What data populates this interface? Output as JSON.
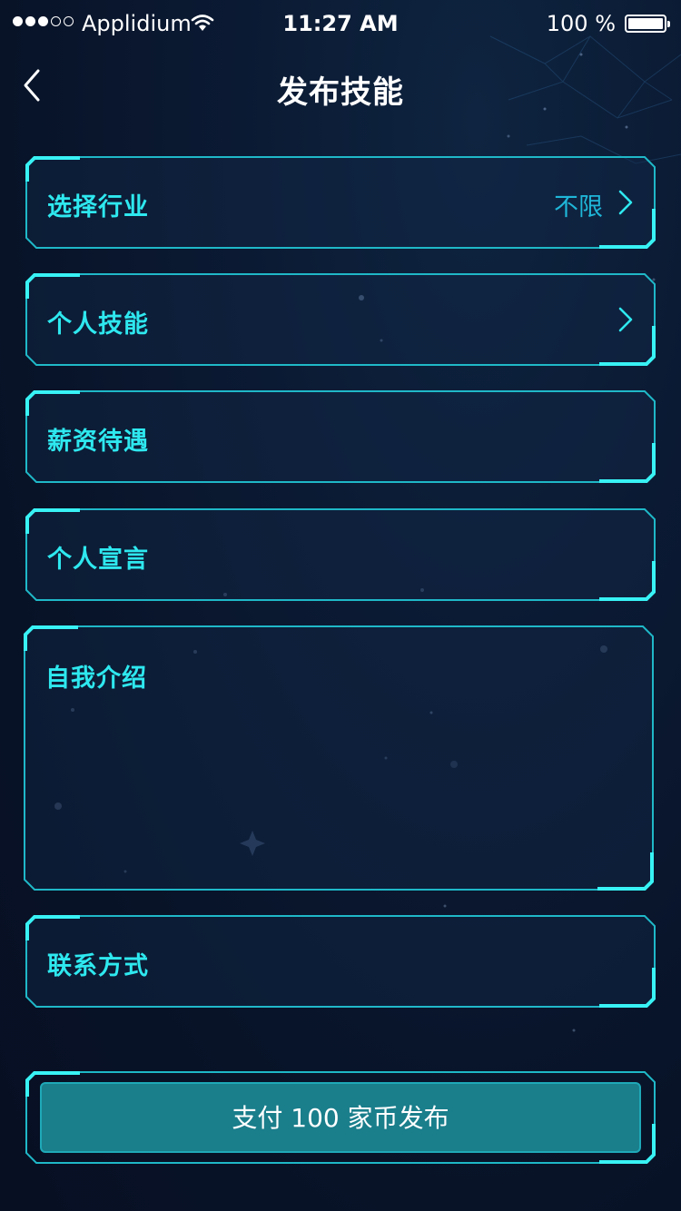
{
  "status_bar": {
    "carrier": "Applidium",
    "time": "11:27 AM",
    "battery": "100 %"
  },
  "nav": {
    "title": "发布技能",
    "back_icon": "chevron-left-icon"
  },
  "form": {
    "industry": {
      "label": "选择行业",
      "value": "不限"
    },
    "skill": {
      "label": "个人技能"
    },
    "salary": {
      "label": "薪资待遇"
    },
    "motto": {
      "label": "个人宣言"
    },
    "intro": {
      "label": "自我介绍"
    },
    "contact": {
      "label": "联系方式"
    }
  },
  "submit": {
    "label": "支付 100 家币发布"
  },
  "colors": {
    "background": "#0b1a33",
    "accent": "#38f2f5",
    "label": "#2ee8ef",
    "value": "#1fb6d8",
    "button": "#1a7e8b"
  }
}
